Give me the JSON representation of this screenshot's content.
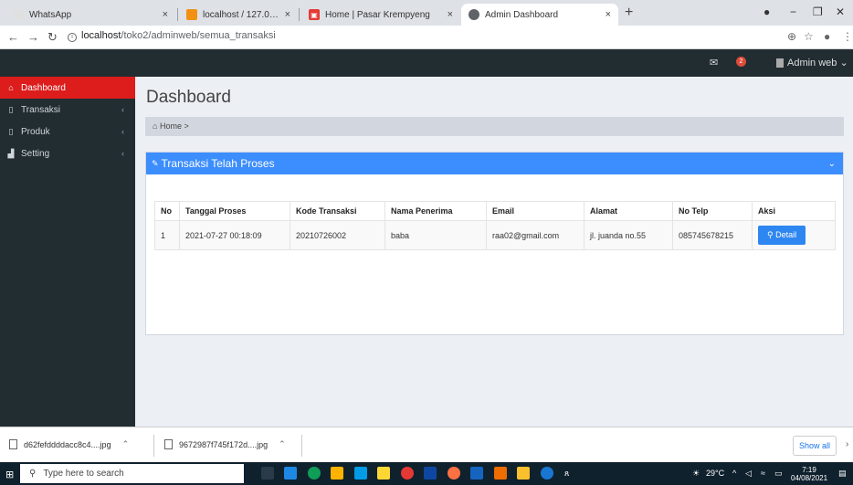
{
  "browser": {
    "tabs": [
      {
        "title": "WhatsApp",
        "favicon_color": "#e0e0e0"
      },
      {
        "title": "localhost / 127.0.0.1 / db_pasar1",
        "favicon_color": "#f29111"
      },
      {
        "title": "Home | Pasar Krempyeng",
        "favicon_color": "#e53935"
      },
      {
        "title": "Admin Dashboard",
        "favicon_color": "#5f6368"
      }
    ],
    "url_host": "localhost",
    "url_path": "/toko2/adminweb/semua_transaksi"
  },
  "topnav": {
    "notif_count": "2",
    "user_label": "Admin web"
  },
  "sidebar": {
    "items": [
      {
        "label": "Dashboard",
        "icon": "home-icon"
      },
      {
        "label": "Transaksi",
        "icon": "bookmark-icon"
      },
      {
        "label": "Produk",
        "icon": "bookmark-icon"
      },
      {
        "label": "Setting",
        "icon": "bar-chart-icon"
      }
    ]
  },
  "main": {
    "page_title": "Dashboard",
    "breadcrumb_home": "Home",
    "breadcrumb_sep": ">",
    "box_title": "Transaksi Telah Proses",
    "table": {
      "columns": [
        "No",
        "Tanggal Proses",
        "Kode Transaksi",
        "Nama Penerima",
        "Email",
        "Alamat",
        "No Telp",
        "Aksi"
      ],
      "rows": [
        {
          "no": "1",
          "tanggal": "2021-07-27 00:18:09",
          "kode": "20210726002",
          "nama": "baba",
          "email": "raa02@gmail.com",
          "alamat": "jl. juanda no.55",
          "telp": "085745678215",
          "aksi": "Detail"
        }
      ]
    }
  },
  "downloads": {
    "items": [
      "d62fefddddacc8c4....jpg",
      "9672987f745f172d....jpg"
    ],
    "show_all": "Show all"
  },
  "taskbar": {
    "search_placeholder": "Type here to search",
    "weather": "29°C",
    "time": "7:19",
    "date": "04/08/2021"
  }
}
